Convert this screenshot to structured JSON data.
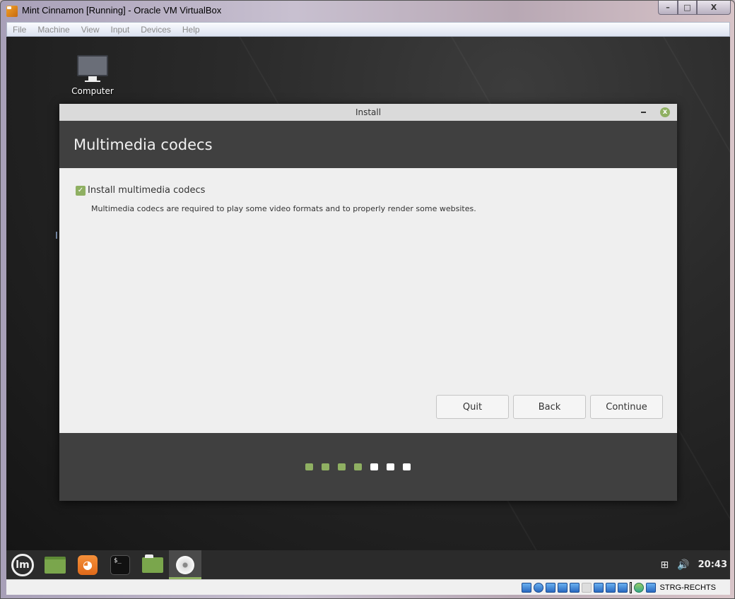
{
  "window": {
    "title": "Mint Cinnamon [Running] - Oracle VM VirtualBox",
    "controls": {
      "minimize": "–",
      "maximize": "□",
      "close": "X"
    }
  },
  "menubar": {
    "items": [
      "File",
      "Machine",
      "View",
      "Input",
      "Devices",
      "Help"
    ]
  },
  "desktop": {
    "icons": [
      {
        "label": "Computer",
        "icon": "computer-icon"
      }
    ]
  },
  "dialog": {
    "title": "Install",
    "min_glyph": "",
    "close_glyph": "x",
    "heading": "Multimedia codecs",
    "checkbox": {
      "label": "Install multimedia codecs",
      "checked": true,
      "glyph": "✓"
    },
    "description": "Multimedia codecs are required to play some video formats and to properly render some websites.",
    "buttons": {
      "quit": "Quit",
      "back": "Back",
      "continue": "Continue"
    },
    "progress": {
      "total_steps": 7,
      "completed_steps": 4
    }
  },
  "panel": {
    "launchers": [
      {
        "name": "menu",
        "icon": "mint-logo-icon",
        "glyph": "lm"
      },
      {
        "name": "show-desktop",
        "icon": "desktop-icon"
      },
      {
        "name": "firefox",
        "icon": "firefox-icon",
        "glyph": "🦊"
      },
      {
        "name": "terminal",
        "icon": "terminal-icon",
        "glyph": "$_"
      },
      {
        "name": "files",
        "icon": "folder-icon"
      },
      {
        "name": "install",
        "icon": "disc-icon",
        "active": true
      }
    ],
    "tray": {
      "network_glyph": "⊞",
      "volume_glyph": "🔊",
      "clock": "20:43"
    }
  },
  "statusbar": {
    "host_key": "STRG-RECHTS"
  },
  "colors": {
    "accent": "#8fb062",
    "header": "#404040",
    "dialog_bg": "#efefef"
  }
}
